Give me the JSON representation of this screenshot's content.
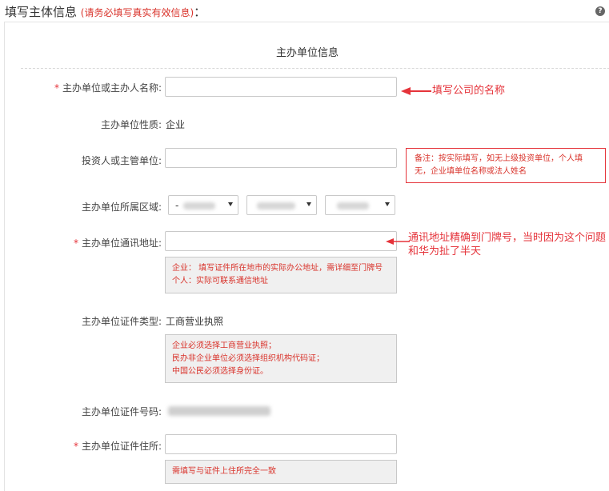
{
  "header": {
    "title": "填写主体信息",
    "note": "(请务必填写真实有效信息)",
    "colon": "："
  },
  "section_title": "主办单位信息",
  "fields": {
    "name": {
      "label": "主办单位或主办人名称:",
      "required": "*",
      "value": "",
      "annotation": "填写公司的名称"
    },
    "nature": {
      "label": "主办单位性质:",
      "value": "企业"
    },
    "investor": {
      "label": "投资人或主管单位:",
      "value": "",
      "note": "备注：按实际填写，如无上级投资单位，个人填无，企业填单位名称或法人姓名"
    },
    "region": {
      "label": "主办单位所属区域:",
      "selects": [
        {
          "value": "-"
        },
        {
          "value": ""
        },
        {
          "value": ""
        }
      ]
    },
    "address": {
      "label": "主办单位通讯地址:",
      "required": "*",
      "value": "",
      "hint_line1": "企业： 填写证件所在地市的实际办公地址，需详细至门牌号",
      "hint_line2": "个人：实际可联系通信地址",
      "annotation_line1": "通讯地址精确到门牌号，当时因为这个问题",
      "annotation_line2": "和华为扯了半天"
    },
    "cert_type": {
      "label": "主办单位证件类型:",
      "value": "工商营业执照",
      "hint_line1": "企业必须选择工商营业执照；",
      "hint_line2": "民办非企业单位必须选择组织机构代码证；",
      "hint_line3": "中国公民必须选择身份证。"
    },
    "cert_no": {
      "label": "主办单位证件号码:"
    },
    "cert_address": {
      "label": "主办单位证件住所:",
      "required": "*",
      "value": "",
      "hint": "需填写与证件上住所完全一致"
    }
  },
  "colors": {
    "required": "#e5333a",
    "annotation": "#e5333a",
    "hint_text": "#d9332b",
    "hint_bg": "#f0f0f0"
  }
}
